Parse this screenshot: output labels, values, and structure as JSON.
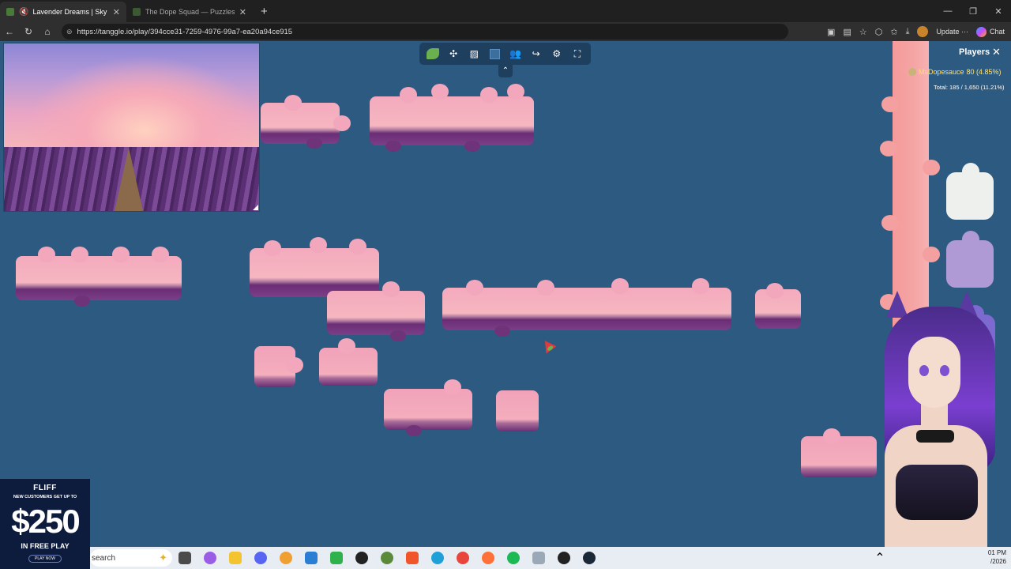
{
  "browser": {
    "tabs": [
      {
        "title": "Lavender Dreams | Sky Jig",
        "active": true
      },
      {
        "title": "The Dope Squad — Puzzles",
        "active": false
      }
    ],
    "new_tab_symbol": "+",
    "window_controls": [
      "—",
      "❐",
      "✕"
    ],
    "url": "https://tanggle.io/play/394cce31-7259-4976-99a7-ea20a94ce915",
    "update_label": "Update",
    "update_more": "···",
    "chat_label": "Chat"
  },
  "game": {
    "toolbar_icons": [
      "leaf-logo-icon",
      "puzzle-piece-icon",
      "image-icon",
      "background-color-icon",
      "players-icon",
      "share-icon",
      "settings-icon",
      "fullscreen-icon"
    ],
    "collapse_symbol": "⌃"
  },
  "players_panel": {
    "title": "Players",
    "close_symbol": "✕",
    "player_name": "MsDopesauce",
    "player_score": "80 (4.85%)",
    "total": "Total: 185 / 1,650 (11.21%)"
  },
  "ad": {
    "brand": "FLIFF",
    "promo": "NEW CUSTOMERS GET UP TO",
    "amount": "$250",
    "sub": "IN FREE PLAY",
    "cta": "PLAY NOW"
  },
  "taskbar": {
    "search_placeholder": "search",
    "clock_time": "01 PM",
    "clock_date": "/2026"
  },
  "colors": {
    "board_bg": "#2d5a80",
    "toolbar_bg": "#1e3f5e",
    "piece_pink": "#f3aabd",
    "lavender": "#6b2e75",
    "player_name_color": "#ffe070"
  }
}
